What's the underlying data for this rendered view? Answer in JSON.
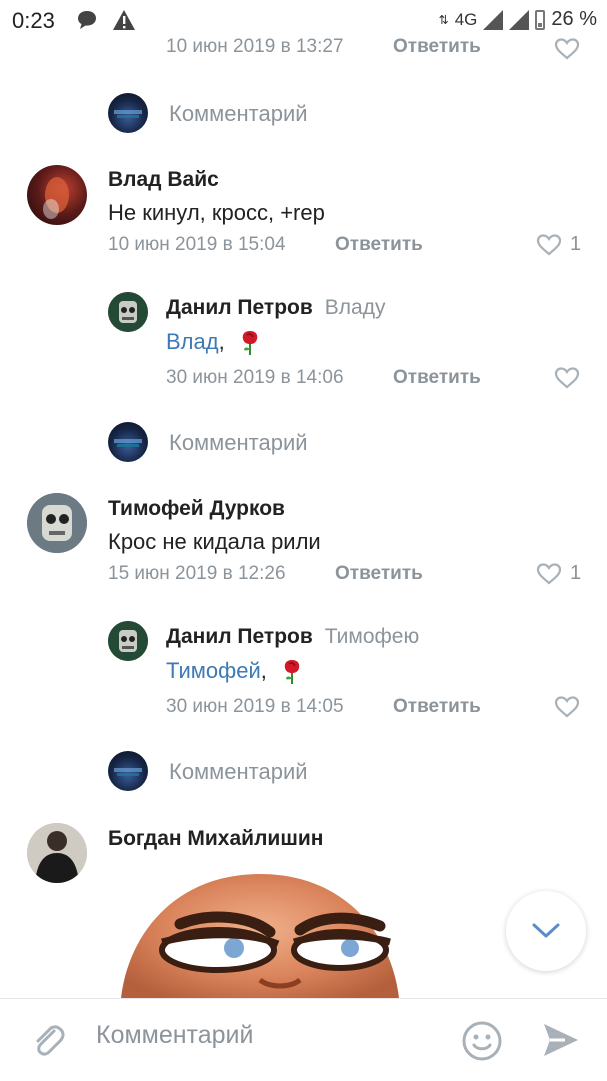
{
  "status_bar": {
    "time": "0:23",
    "network": "4G",
    "battery": "26 %"
  },
  "top_partial": {
    "date": "10 июн 2019 в 13:27",
    "reply_label": "Ответить"
  },
  "comment_prompt_1": "Комментарий",
  "comment1": {
    "author": "Влад Вайс",
    "text": "Не кинул, кросс, +rep",
    "date": "10 июн 2019 в 15:04",
    "reply_label": "Ответить",
    "likes": "1"
  },
  "reply1": {
    "author": "Данил Петров",
    "reply_to": "Владу",
    "mention": "Влад",
    "suffix": ",",
    "date": "30 июн 2019 в 14:06",
    "reply_label": "Ответить"
  },
  "comment_prompt_2": "Комментарий",
  "comment2": {
    "author": "Тимофей Дурков",
    "text": "Крос не кидала рили",
    "date": "15 июн 2019 в 12:26",
    "reply_label": "Ответить",
    "likes": "1"
  },
  "reply2": {
    "author": "Данил Петров",
    "reply_to": "Тимофею",
    "mention": "Тимофей",
    "suffix": ",",
    "date": "30 июн 2019 в 14:05",
    "reply_label": "Ответить"
  },
  "comment_prompt_3": "Комментарий",
  "comment3": {
    "author": "Богдан Михайлишин"
  },
  "composer": {
    "placeholder": "Комментарий"
  },
  "colors": {
    "accent": "#3d7ab5",
    "secondary_text": "#8c949b",
    "like_icon": "#a8b0b8"
  }
}
